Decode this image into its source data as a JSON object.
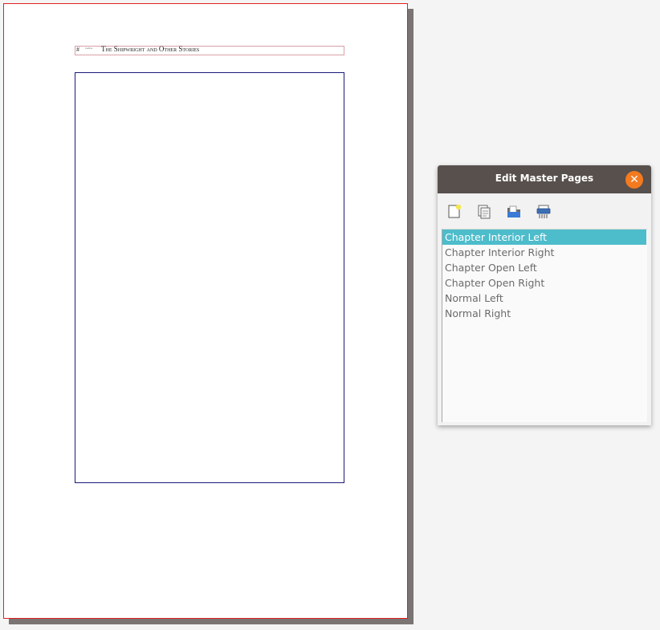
{
  "document": {
    "header": {
      "page_number_marker": "#",
      "flourish": "~·~",
      "running_title": "The Shipwright and Other Stories"
    }
  },
  "dialog": {
    "title": "Edit Master Pages",
    "close_icon": "close-icon",
    "toolbar": {
      "new_icon": "new-page-icon",
      "duplicate_icon": "duplicate-page-icon",
      "import_icon": "import-folder-icon",
      "delete_icon": "shredder-icon"
    },
    "master_pages": [
      {
        "label": "Chapter Interior Left",
        "selected": true
      },
      {
        "label": "Chapter Interior Right",
        "selected": false
      },
      {
        "label": "Chapter Open Left",
        "selected": false
      },
      {
        "label": "Chapter Open Right",
        "selected": false
      },
      {
        "label": "Normal Left",
        "selected": false
      },
      {
        "label": "Normal Right",
        "selected": false
      }
    ]
  },
  "colors": {
    "titlebar": "#57504c",
    "close_button": "#f47a20",
    "selection": "#4dbccb",
    "page_border": "#e02020",
    "text_frame_border": "#1a1a7a"
  }
}
